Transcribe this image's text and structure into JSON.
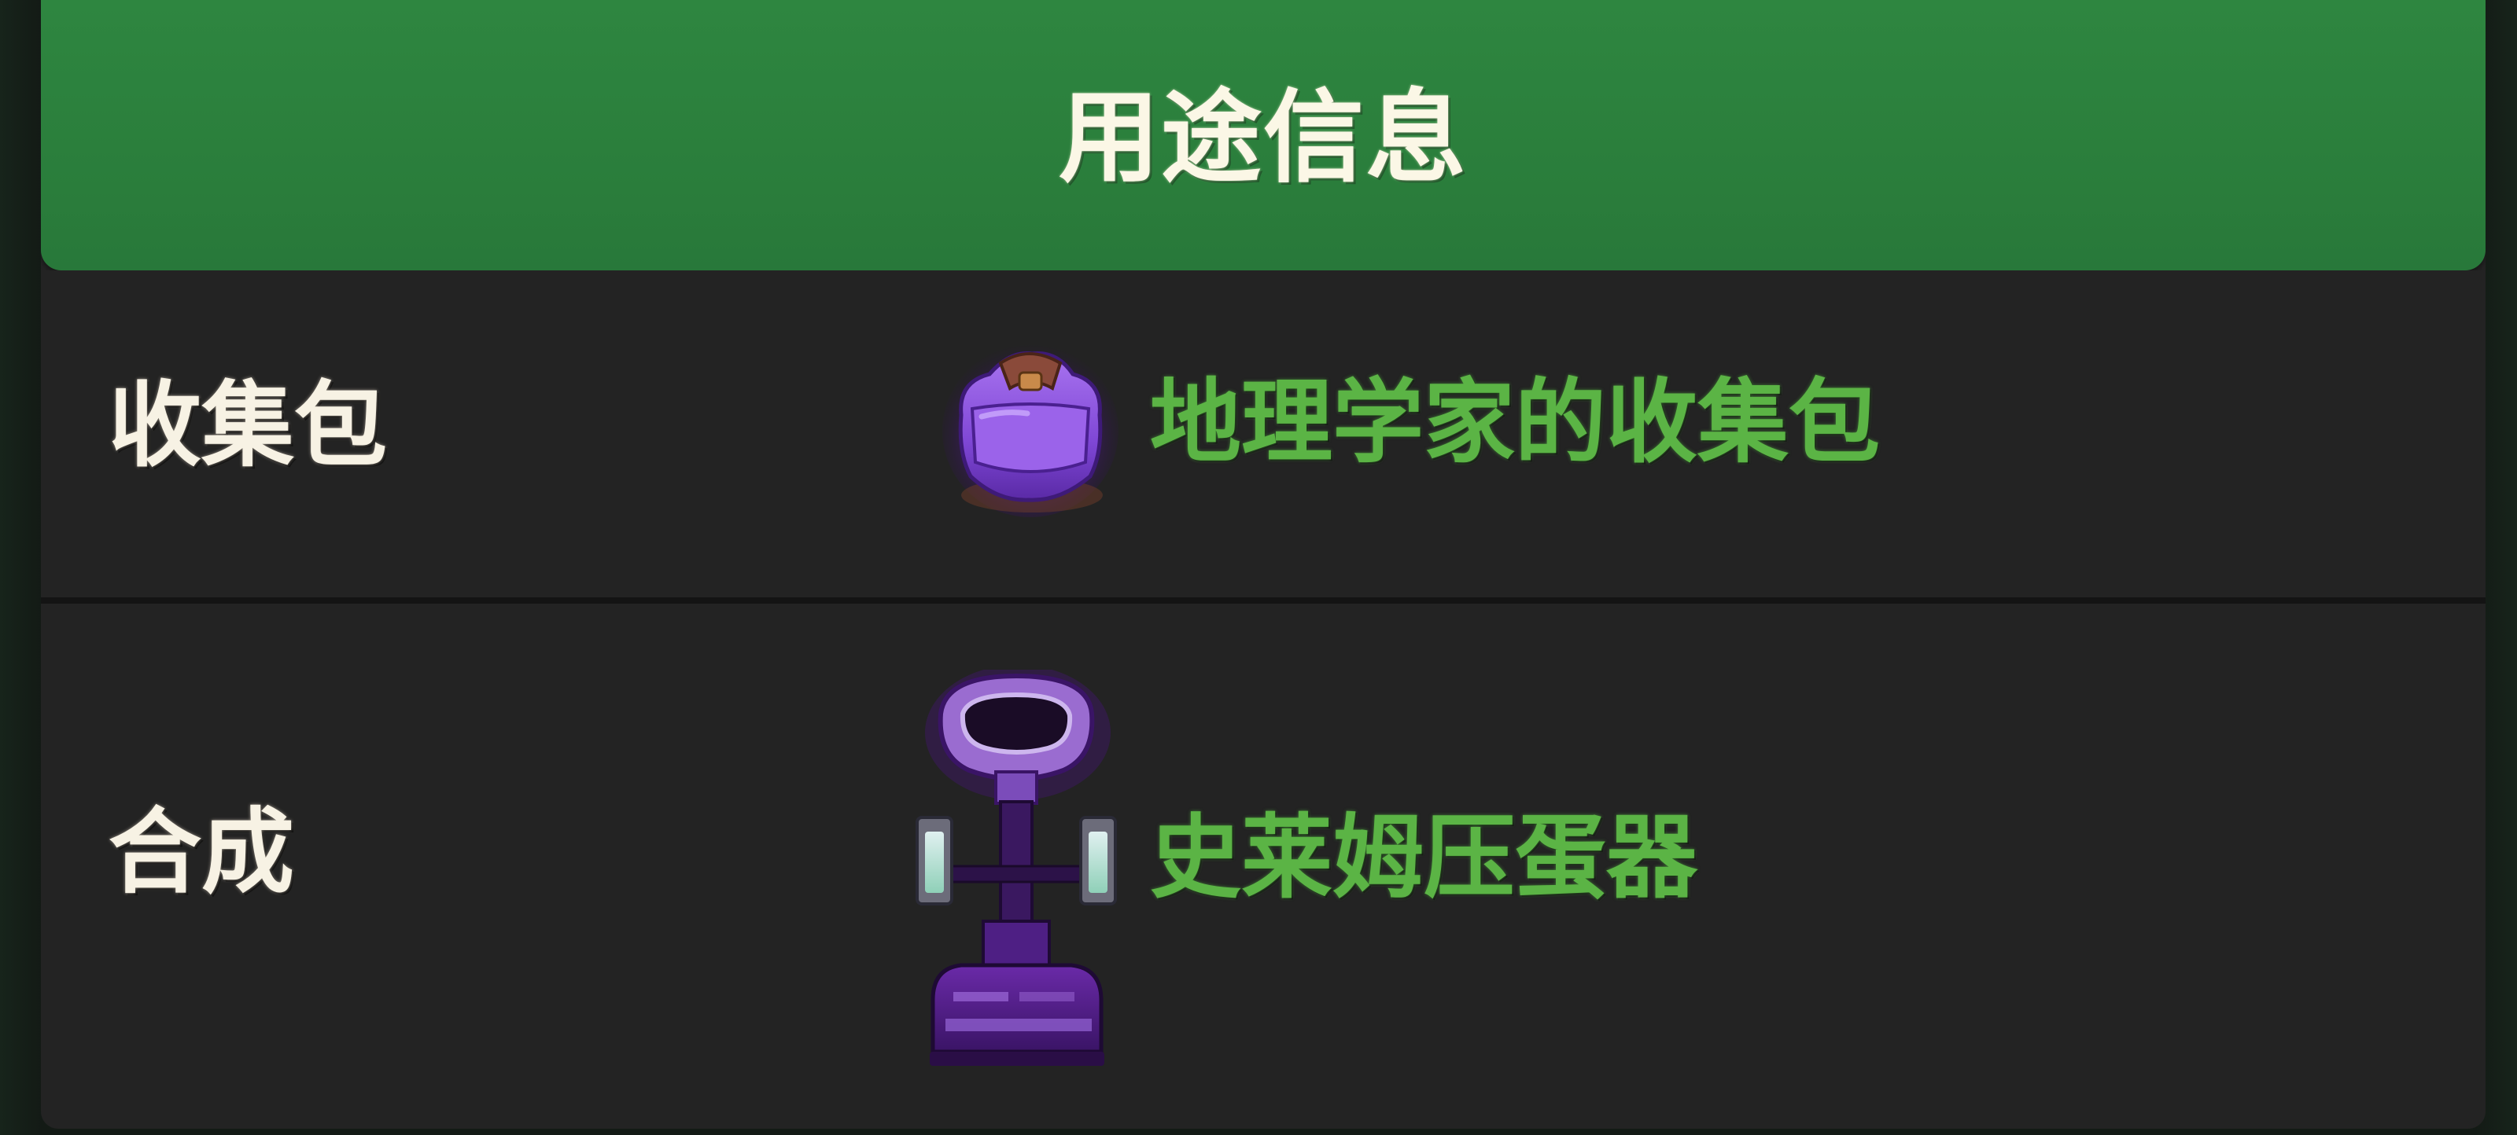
{
  "header": {
    "title": "用途信息"
  },
  "rows": [
    {
      "label": "收集包",
      "item": {
        "name": "地理学家的收集包",
        "icon": "purple-collection-bag-icon",
        "color": "#5bb445"
      }
    },
    {
      "label": "合成",
      "item": {
        "name": "史莱姆压蛋器",
        "icon": "slime-egg-press-machine-icon",
        "color": "#5bb445"
      }
    }
  ],
  "colors": {
    "header_green": "#2e8640",
    "panel_background": "#232323",
    "label_text": "#f7f2e4",
    "item_link_text": "#5bb445",
    "item_rarity_purple": "#8a4fd8"
  }
}
